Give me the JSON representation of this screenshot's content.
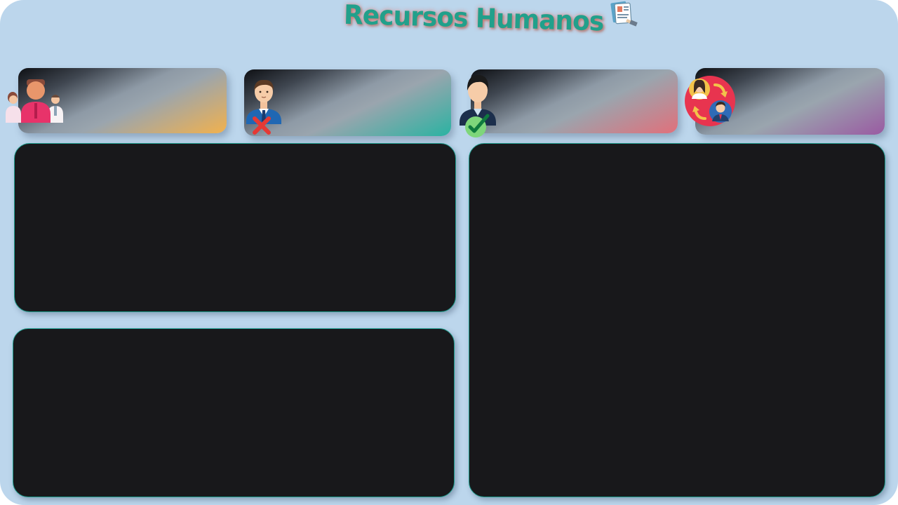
{
  "header": {
    "title": "Recursos Humanos",
    "title_color": "#21a08b",
    "title_icon": "clipboard-resume-icon"
  },
  "kpi_cards": [
    {
      "name": "total-employees",
      "icon": "employee-group-icon",
      "accent": "#f1b14e"
    },
    {
      "name": "dismissed-employees",
      "icon": "employee-rejected-icon",
      "accent": "#2ab3a2"
    },
    {
      "name": "hired-employees",
      "icon": "employee-approved-icon",
      "accent": "#e1707b"
    },
    {
      "name": "turnover",
      "icon": "employee-rotation-icon",
      "accent": "#9a5aa2"
    }
  ],
  "panels": [
    {
      "name": "chart-panel-top-left"
    },
    {
      "name": "chart-panel-bottom-left"
    },
    {
      "name": "chart-panel-right"
    }
  ],
  "colors": {
    "background": "#bcd6ec",
    "panel": "#18181b",
    "panel_border": "#1e9c8c"
  }
}
